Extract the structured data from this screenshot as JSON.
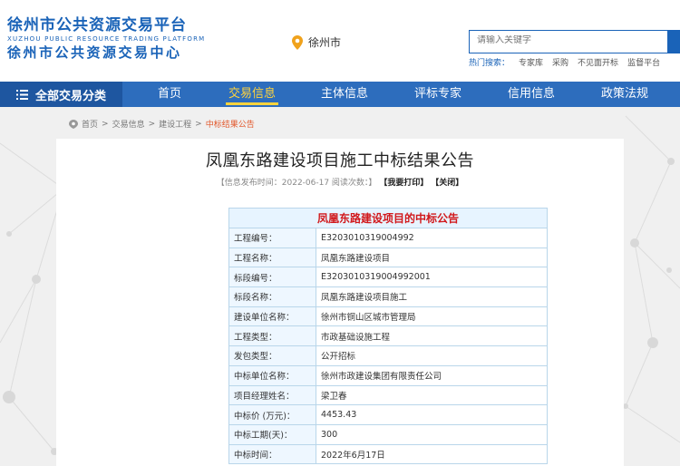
{
  "header": {
    "logo_line1": "徐州市公共资源交易平台",
    "logo_line_en": "XUZHOU PUBLIC RESOURCE TRADING PLATFORM",
    "logo_line2": "徐州市公共资源交易中心",
    "location": "徐州市",
    "search_placeholder": "请输入关键字",
    "hot_label": "热门搜索：",
    "hot_items": [
      "专家库",
      "采购",
      "不见面开标",
      "监督平台"
    ]
  },
  "nav": {
    "all_label": "全部交易分类",
    "items": [
      "首页",
      "交易信息",
      "主体信息",
      "评标专家",
      "信用信息",
      "政策法规"
    ],
    "active_index": 1
  },
  "breadcrumb": {
    "items": [
      "首页",
      "交易信息",
      "建设工程",
      "中标结果公告"
    ],
    "separator": ">"
  },
  "article": {
    "title": "凤凰东路建设项目施工中标结果公告",
    "meta_prefix": "【信息发布时间：2022-06-17 阅读次数：】",
    "print_label": "【我要打印】",
    "close_label": "【关闭】"
  },
  "table": {
    "heading": "凤凰东路建设项目的中标公告",
    "rows": [
      {
        "key": "工程编号：",
        "value": "E3203010319004992"
      },
      {
        "key": "工程名称：",
        "value": "凤凰东路建设项目"
      },
      {
        "key": "标段编号：",
        "value": "E3203010319004992001"
      },
      {
        "key": "标段名称：",
        "value": "凤凰东路建设项目施工"
      },
      {
        "key": "建设单位名称：",
        "value": "徐州市铜山区城市管理局"
      },
      {
        "key": "工程类型：",
        "value": "市政基础设施工程"
      },
      {
        "key": "发包类型：",
        "value": "公开招标"
      },
      {
        "key": "中标单位名称：",
        "value": "徐州市政建设集团有限责任公司"
      },
      {
        "key": "项目经理姓名：",
        "value": "梁卫春"
      },
      {
        "key": "中标价 (万元)：",
        "value": "4453.43"
      },
      {
        "key": "中标工期(天)：",
        "value": "300"
      },
      {
        "key": "中标时间：",
        "value": "2022年6月17日"
      }
    ]
  },
  "colors": {
    "brand": "#1a63b8",
    "nav": "#2d6dbd",
    "active": "#ffd33d",
    "highlight": "#d1181b"
  }
}
